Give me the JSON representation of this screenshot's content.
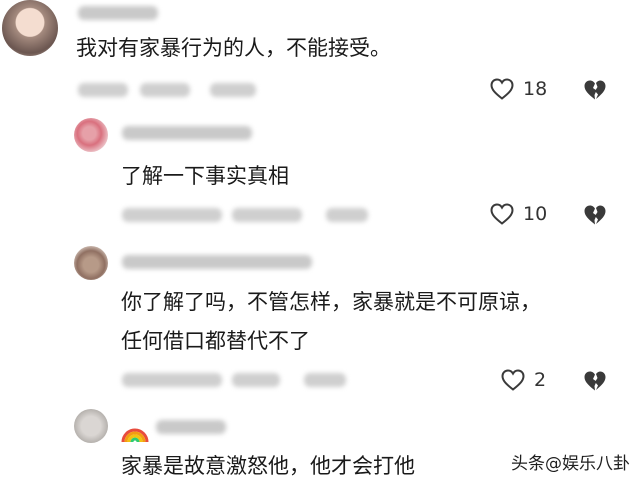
{
  "comments": [
    {
      "text": "我对有家暴行为的人，不能接受。",
      "likes": "18"
    },
    {
      "text": "了解一下事实真相",
      "likes": "10"
    },
    {
      "text_line1": "你了解了吗，不管怎样，家暴就是不可原谅，",
      "text_line2": "任何借口都替代不了",
      "likes": "2"
    },
    {
      "text": "家暴是故意激怒他，他才会打他"
    }
  ],
  "watermark": "头条@娱乐八卦",
  "icons": {
    "like": "heart-outline-icon",
    "dislike": "broken-heart-icon",
    "badge": "rainbow-icon"
  },
  "colors": {
    "text": "#1a1a1a",
    "icon": "#3a3a3a",
    "blurred_meta": "#cfcfcf"
  }
}
